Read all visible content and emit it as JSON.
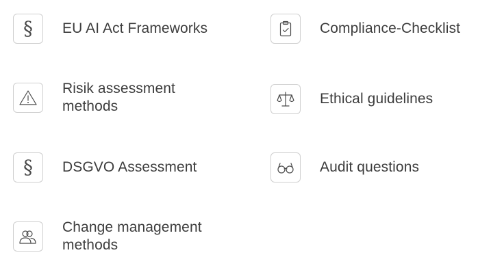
{
  "colors": {
    "text": "#3d3d3d",
    "icon_stroke": "#4a4a4a",
    "icon_border": "#cfcfcf"
  },
  "items": [
    {
      "label": "EU AI Act Frameworks",
      "icon": "section-sign-icon"
    },
    {
      "label": "Compliance-Checklist",
      "icon": "clipboard-check-icon"
    },
    {
      "label": "Risik assessment methods",
      "icon": "warning-triangle-icon"
    },
    {
      "label": "Ethical guidelines",
      "icon": "scales-icon"
    },
    {
      "label": "DSGVO Assessment",
      "icon": "section-sign-icon"
    },
    {
      "label": "Audit questions",
      "icon": "glasses-icon"
    },
    {
      "label": "Change management methods",
      "icon": "users-icon"
    }
  ]
}
